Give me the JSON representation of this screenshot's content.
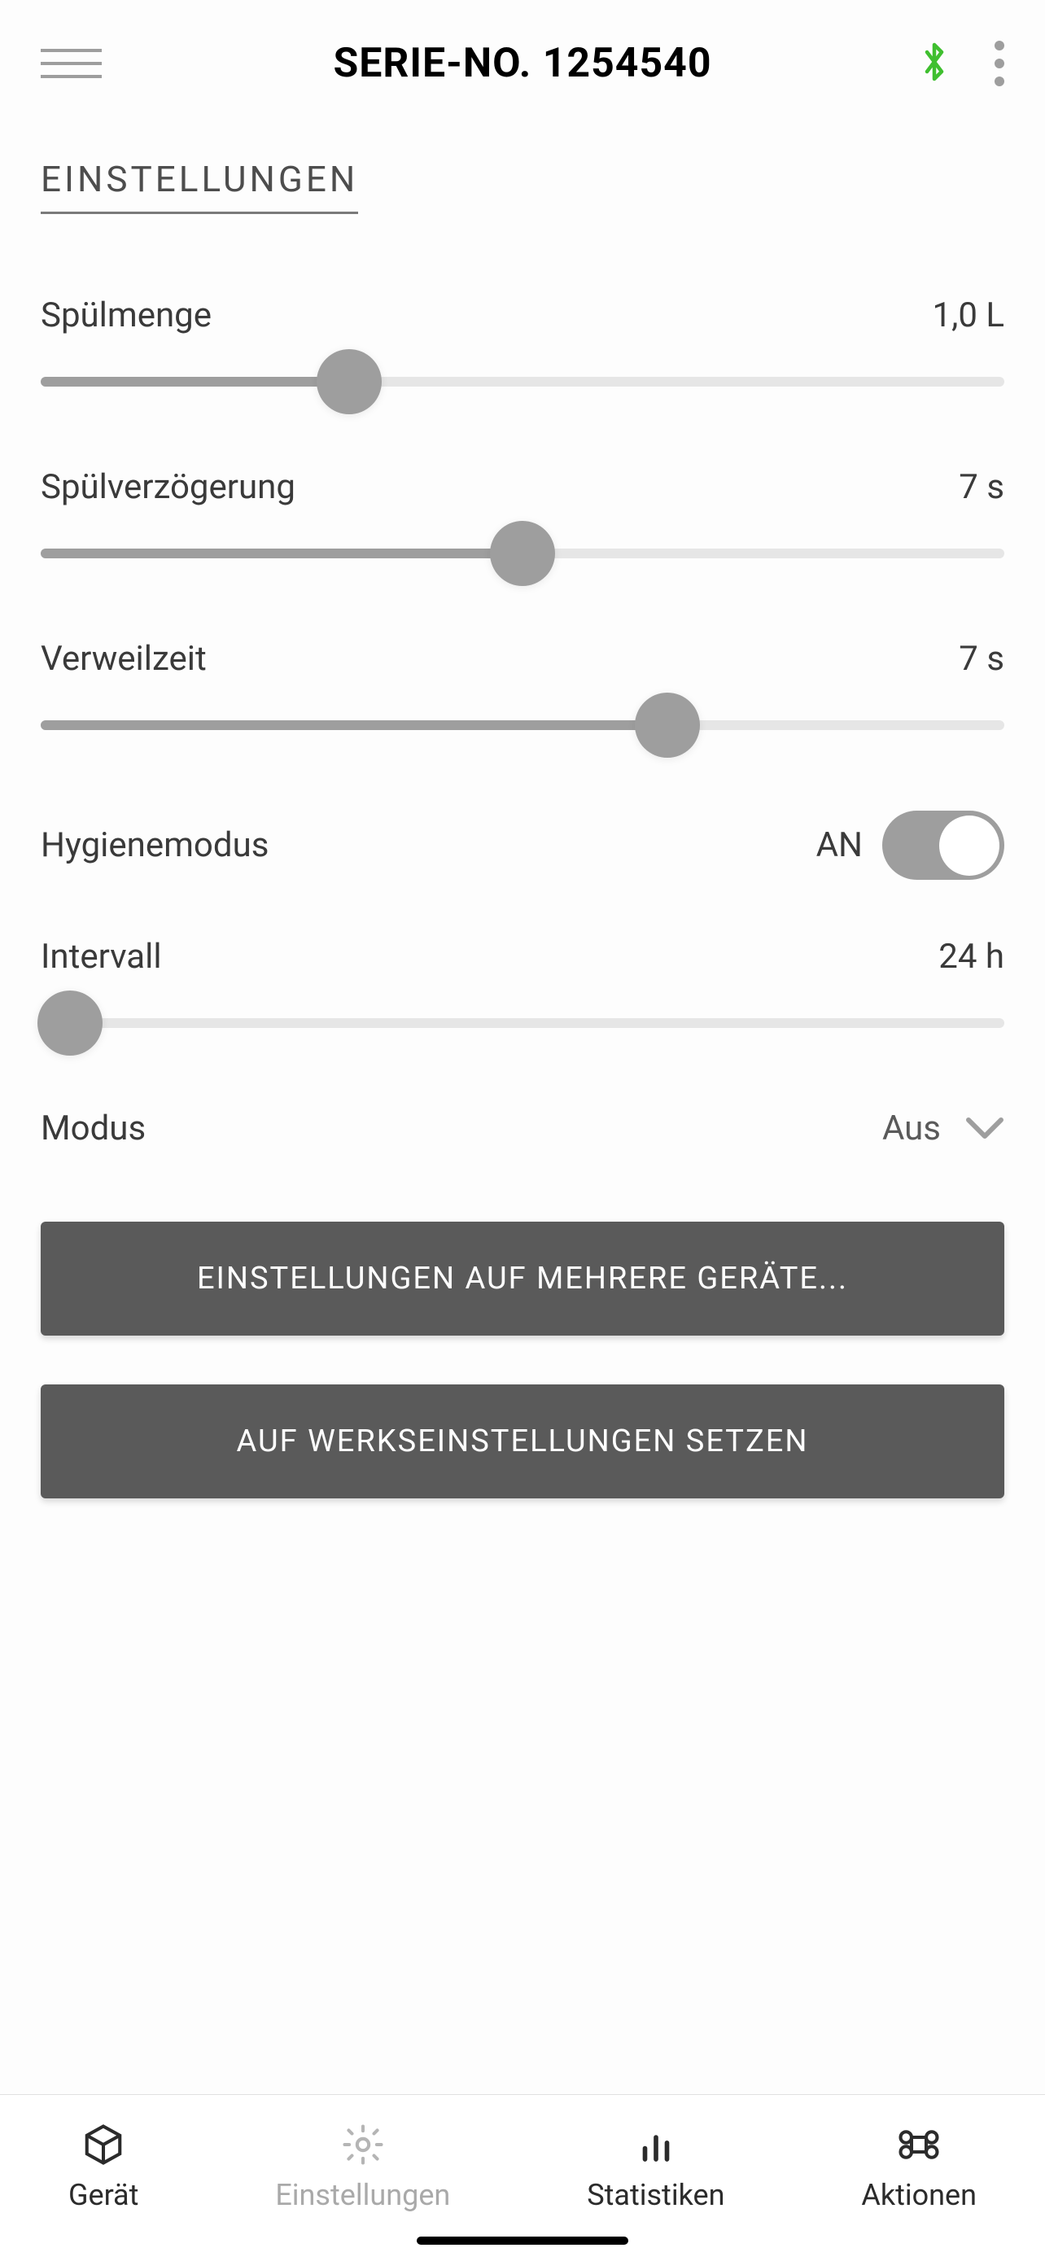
{
  "header": {
    "title": "SERIE-NO. 1254540"
  },
  "tab": {
    "title": "EINSTELLUNGEN"
  },
  "settings": {
    "flushVolume": {
      "label": "Spülmenge",
      "value": "1,0 L",
      "percent": 32
    },
    "flushDelay": {
      "label": "Spülverzögerung",
      "value": "7 s",
      "percent": 50
    },
    "dwellTime": {
      "label": "Verweilzeit",
      "value": "7 s",
      "percent": 65
    },
    "hygieneMode": {
      "label": "Hygienemodus",
      "state": "AN",
      "on": true
    },
    "interval": {
      "label": "Intervall",
      "value": "24 h",
      "percent": 3
    },
    "mode": {
      "label": "Modus",
      "selected": "Aus"
    }
  },
  "buttons": {
    "applyMultiple": "EINSTELLUNGEN AUF MEHRERE GERÄTE...",
    "factoryReset": "AUF WERKSEINSTELLUNGEN SETZEN"
  },
  "bottomNav": {
    "device": "Gerät",
    "settings": "Einstellungen",
    "statistics": "Statistiken",
    "actions": "Aktionen"
  }
}
